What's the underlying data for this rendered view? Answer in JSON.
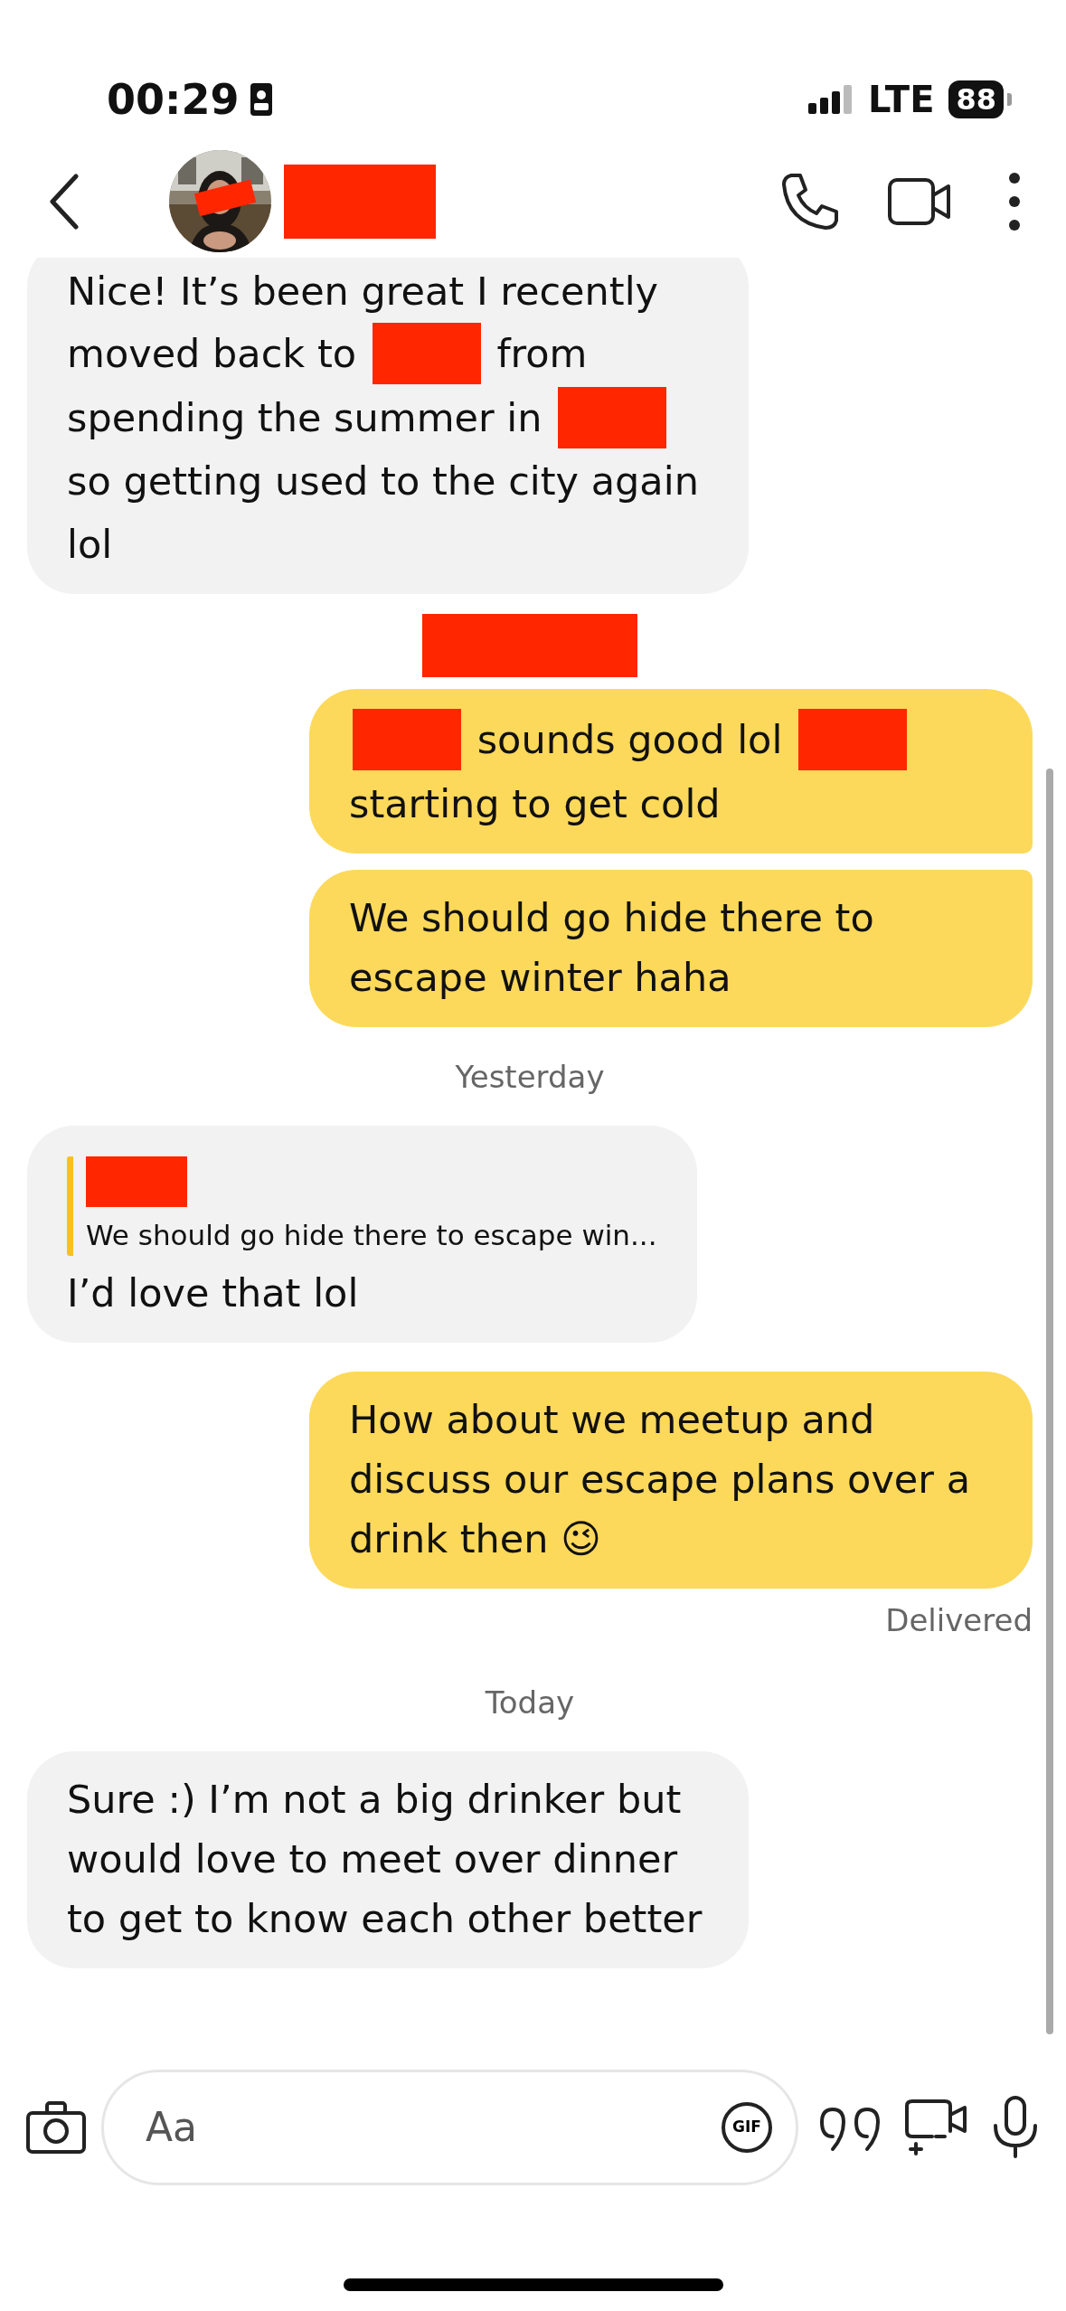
{
  "status_bar": {
    "time": "00:29",
    "network": "LTE",
    "battery": "88"
  },
  "header": {
    "avatar": {
      "kind": "picture",
      "redacted": true
    },
    "name_redacted": true
  },
  "messages": [
    {
      "kind": "incoming",
      "parts": [
        {
          "kind": "text",
          "text": "Nice! It’s been great I recently"
        },
        {
          "kind": "text",
          "text": "moved back to"
        },
        {
          "kind": "redaction"
        },
        {
          "kind": "text",
          "text": "from"
        },
        {
          "kind": "text",
          "text": "spending the summer in"
        },
        {
          "kind": "redaction"
        },
        {
          "kind": "text",
          "text": "so getting used to the city again"
        },
        {
          "kind": "text",
          "text": "lol"
        }
      ]
    },
    {
      "kind": "redaction"
    },
    {
      "kind": "outgoing",
      "parts": [
        {
          "kind": "redaction"
        },
        {
          "kind": "text",
          "text": "sounds good lol"
        },
        {
          "kind": "redaction"
        },
        {
          "kind": "text",
          "text": "starting to get cold"
        }
      ]
    },
    {
      "kind": "outgoing",
      "parts": [
        {
          "kind": "text",
          "text": "We should go hide there to escape winter haha"
        }
      ]
    },
    {
      "kind": "date",
      "text": "Yesterday"
    },
    {
      "kind": "incoming",
      "reply": {
        "sender_redacted": true,
        "text": "We should go hide there to escape win..."
      },
      "parts": [
        {
          "kind": "text",
          "text": "I’d love that lol"
        }
      ]
    },
    {
      "kind": "outgoing",
      "parts": [
        {
          "kind": "text",
          "text": "How about we meetup and discuss our escape plans over a drink then 😉"
        }
      ]
    },
    {
      "kind": "status",
      "text": "Delivered"
    },
    {
      "kind": "date",
      "text": "Today"
    },
    {
      "kind": "incoming",
      "parts": [
        {
          "kind": "text",
          "text": "Sure :) I’m not a big drinker but would love to meet over dinner to get to know each other better"
        }
      ]
    }
  ],
  "composer": {
    "placeholder": "Aa",
    "gif_label": "GIF"
  }
}
